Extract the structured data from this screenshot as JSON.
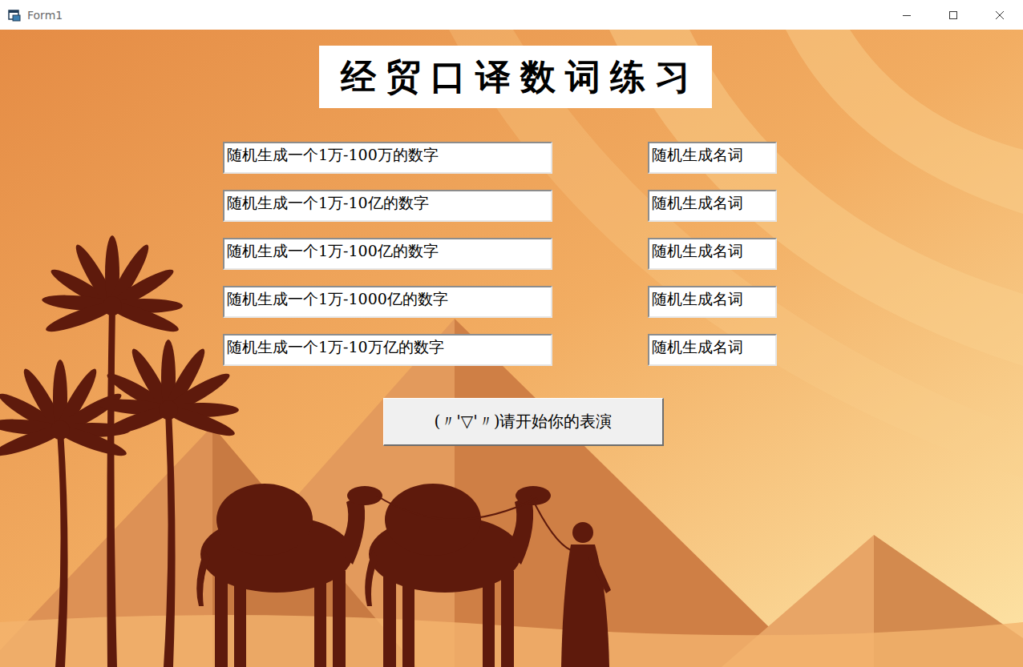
{
  "window": {
    "title": "Form1"
  },
  "heading": "经贸口译数词练习",
  "rows": [
    {
      "number_field": "随机生成一个1万-100万的数字",
      "noun_field": "随机生成名词"
    },
    {
      "number_field": "随机生成一个1万-10亿的数字",
      "noun_field": "随机生成名词"
    },
    {
      "number_field": "随机生成一个1万-100亿的数字",
      "noun_field": "随机生成名词"
    },
    {
      "number_field": "随机生成一个1万-1000亿的数字",
      "noun_field": "随机生成名词"
    },
    {
      "number_field": "随机生成一个1万-10万亿的数字",
      "noun_field": "随机生成名词"
    }
  ],
  "start_button": "(〃'▽'〃)请开始你的表演"
}
